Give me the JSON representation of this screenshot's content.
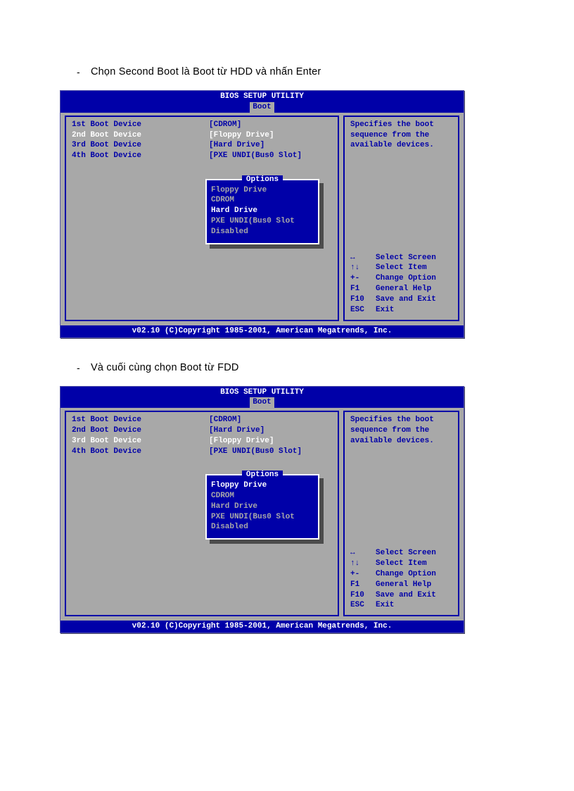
{
  "captions": {
    "bullet": "-",
    "cap1": "Chọn Second Boot là Boot từ HDD và nhấn Enter",
    "cap2": "Và cuối cùng chọn Boot từ FDD"
  },
  "bios1": {
    "title": "BIOS SETUP UTILITY",
    "tab": "Boot",
    "rows": [
      {
        "label": "1st Boot Device",
        "value": "[CDROM]",
        "sel": false
      },
      {
        "label": "2nd Boot Device",
        "value": "[Floppy Drive]",
        "sel": true
      },
      {
        "label": "3rd Boot Device",
        "value": "[Hard Drive]",
        "sel": false
      },
      {
        "label": "4th Boot Device",
        "value": "[PXE UNDI(Bus0 Slot]",
        "sel": false
      }
    ],
    "options_title": "Options",
    "options": [
      {
        "label": "Floppy Drive",
        "sel": false
      },
      {
        "label": "CDROM",
        "sel": false
      },
      {
        "label": "Hard Drive",
        "sel": true
      },
      {
        "label": "PXE UNDI(Bus0 Slot",
        "sel": false
      },
      {
        "label": "Disabled",
        "sel": false
      }
    ],
    "help": [
      "Specifies the boot",
      "sequence from the",
      "available devices."
    ],
    "keys": [
      {
        "k": "↔",
        "v": "Select Screen"
      },
      {
        "k": "↑↓",
        "v": "Select Item"
      },
      {
        "k": "+-",
        "v": "Change Option"
      },
      {
        "k": "F1",
        "v": "General Help"
      },
      {
        "k": "F10",
        "v": "Save and Exit"
      },
      {
        "k": "ESC",
        "v": "Exit"
      }
    ],
    "footer": "v02.10 (C)Copyright 1985-2001, American Megatrends, Inc."
  },
  "bios2": {
    "title": "BIOS SETUP UTILITY",
    "tab": "Boot",
    "rows": [
      {
        "label": "1st Boot Device",
        "value": "[CDROM]",
        "sel": false
      },
      {
        "label": "2nd Boot Device",
        "value": "[Hard Drive]",
        "sel": false
      },
      {
        "label": "3rd Boot Device",
        "value": "[Floppy Drive]",
        "sel": true
      },
      {
        "label": "4th Boot Device",
        "value": "[PXE UNDI(Bus0 Slot]",
        "sel": false
      }
    ],
    "options_title": "Options",
    "options": [
      {
        "label": "Floppy Drive",
        "sel": true
      },
      {
        "label": "CDROM",
        "sel": false
      },
      {
        "label": "Hard Drive",
        "sel": false
      },
      {
        "label": "PXE UNDI(Bus0 Slot",
        "sel": false
      },
      {
        "label": "Disabled",
        "sel": false
      }
    ],
    "help": [
      "Specifies the boot",
      "sequence from the",
      "available devices."
    ],
    "keys": [
      {
        "k": "↔",
        "v": "Select Screen"
      },
      {
        "k": "↑↓",
        "v": "Select Item"
      },
      {
        "k": "+-",
        "v": "Change Option"
      },
      {
        "k": "F1",
        "v": "General Help"
      },
      {
        "k": "F10",
        "v": "Save and Exit"
      },
      {
        "k": "ESC",
        "v": "Exit"
      }
    ],
    "footer": "v02.10 (C)Copyright 1985-2001, American Megatrends, Inc."
  }
}
